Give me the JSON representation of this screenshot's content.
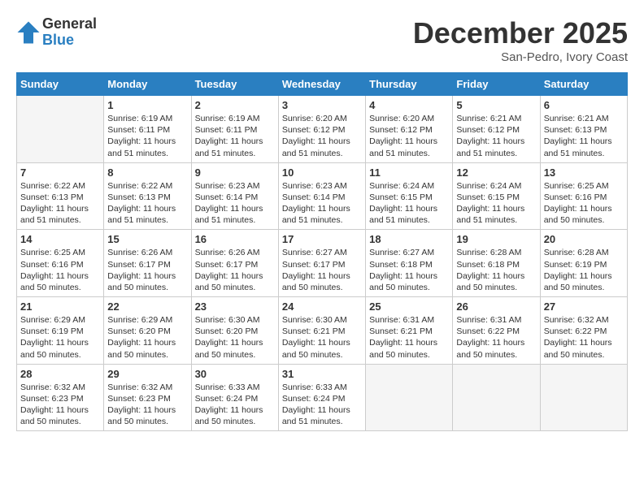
{
  "logo": {
    "general": "General",
    "blue": "Blue"
  },
  "title": "December 2025",
  "location": "San-Pedro, Ivory Coast",
  "days_of_week": [
    "Sunday",
    "Monday",
    "Tuesday",
    "Wednesday",
    "Thursday",
    "Friday",
    "Saturday"
  ],
  "weeks": [
    [
      {
        "day": "",
        "empty": true
      },
      {
        "day": "1",
        "sunrise": "6:19 AM",
        "sunset": "6:11 PM",
        "daylight": "11 hours and 51 minutes."
      },
      {
        "day": "2",
        "sunrise": "6:19 AM",
        "sunset": "6:11 PM",
        "daylight": "11 hours and 51 minutes."
      },
      {
        "day": "3",
        "sunrise": "6:20 AM",
        "sunset": "6:12 PM",
        "daylight": "11 hours and 51 minutes."
      },
      {
        "day": "4",
        "sunrise": "6:20 AM",
        "sunset": "6:12 PM",
        "daylight": "11 hours and 51 minutes."
      },
      {
        "day": "5",
        "sunrise": "6:21 AM",
        "sunset": "6:12 PM",
        "daylight": "11 hours and 51 minutes."
      },
      {
        "day": "6",
        "sunrise": "6:21 AM",
        "sunset": "6:13 PM",
        "daylight": "11 hours and 51 minutes."
      }
    ],
    [
      {
        "day": "7",
        "sunrise": "6:22 AM",
        "sunset": "6:13 PM",
        "daylight": "11 hours and 51 minutes."
      },
      {
        "day": "8",
        "sunrise": "6:22 AM",
        "sunset": "6:13 PM",
        "daylight": "11 hours and 51 minutes."
      },
      {
        "day": "9",
        "sunrise": "6:23 AM",
        "sunset": "6:14 PM",
        "daylight": "11 hours and 51 minutes."
      },
      {
        "day": "10",
        "sunrise": "6:23 AM",
        "sunset": "6:14 PM",
        "daylight": "11 hours and 51 minutes."
      },
      {
        "day": "11",
        "sunrise": "6:24 AM",
        "sunset": "6:15 PM",
        "daylight": "11 hours and 51 minutes."
      },
      {
        "day": "12",
        "sunrise": "6:24 AM",
        "sunset": "6:15 PM",
        "daylight": "11 hours and 51 minutes."
      },
      {
        "day": "13",
        "sunrise": "6:25 AM",
        "sunset": "6:16 PM",
        "daylight": "11 hours and 50 minutes."
      }
    ],
    [
      {
        "day": "14",
        "sunrise": "6:25 AM",
        "sunset": "6:16 PM",
        "daylight": "11 hours and 50 minutes."
      },
      {
        "day": "15",
        "sunrise": "6:26 AM",
        "sunset": "6:17 PM",
        "daylight": "11 hours and 50 minutes."
      },
      {
        "day": "16",
        "sunrise": "6:26 AM",
        "sunset": "6:17 PM",
        "daylight": "11 hours and 50 minutes."
      },
      {
        "day": "17",
        "sunrise": "6:27 AM",
        "sunset": "6:17 PM",
        "daylight": "11 hours and 50 minutes."
      },
      {
        "day": "18",
        "sunrise": "6:27 AM",
        "sunset": "6:18 PM",
        "daylight": "11 hours and 50 minutes."
      },
      {
        "day": "19",
        "sunrise": "6:28 AM",
        "sunset": "6:18 PM",
        "daylight": "11 hours and 50 minutes."
      },
      {
        "day": "20",
        "sunrise": "6:28 AM",
        "sunset": "6:19 PM",
        "daylight": "11 hours and 50 minutes."
      }
    ],
    [
      {
        "day": "21",
        "sunrise": "6:29 AM",
        "sunset": "6:19 PM",
        "daylight": "11 hours and 50 minutes."
      },
      {
        "day": "22",
        "sunrise": "6:29 AM",
        "sunset": "6:20 PM",
        "daylight": "11 hours and 50 minutes."
      },
      {
        "day": "23",
        "sunrise": "6:30 AM",
        "sunset": "6:20 PM",
        "daylight": "11 hours and 50 minutes."
      },
      {
        "day": "24",
        "sunrise": "6:30 AM",
        "sunset": "6:21 PM",
        "daylight": "11 hours and 50 minutes."
      },
      {
        "day": "25",
        "sunrise": "6:31 AM",
        "sunset": "6:21 PM",
        "daylight": "11 hours and 50 minutes."
      },
      {
        "day": "26",
        "sunrise": "6:31 AM",
        "sunset": "6:22 PM",
        "daylight": "11 hours and 50 minutes."
      },
      {
        "day": "27",
        "sunrise": "6:32 AM",
        "sunset": "6:22 PM",
        "daylight": "11 hours and 50 minutes."
      }
    ],
    [
      {
        "day": "28",
        "sunrise": "6:32 AM",
        "sunset": "6:23 PM",
        "daylight": "11 hours and 50 minutes."
      },
      {
        "day": "29",
        "sunrise": "6:32 AM",
        "sunset": "6:23 PM",
        "daylight": "11 hours and 50 minutes."
      },
      {
        "day": "30",
        "sunrise": "6:33 AM",
        "sunset": "6:24 PM",
        "daylight": "11 hours and 50 minutes."
      },
      {
        "day": "31",
        "sunrise": "6:33 AM",
        "sunset": "6:24 PM",
        "daylight": "11 hours and 51 minutes."
      },
      {
        "day": "",
        "empty": true
      },
      {
        "day": "",
        "empty": true
      },
      {
        "day": "",
        "empty": true
      }
    ]
  ]
}
